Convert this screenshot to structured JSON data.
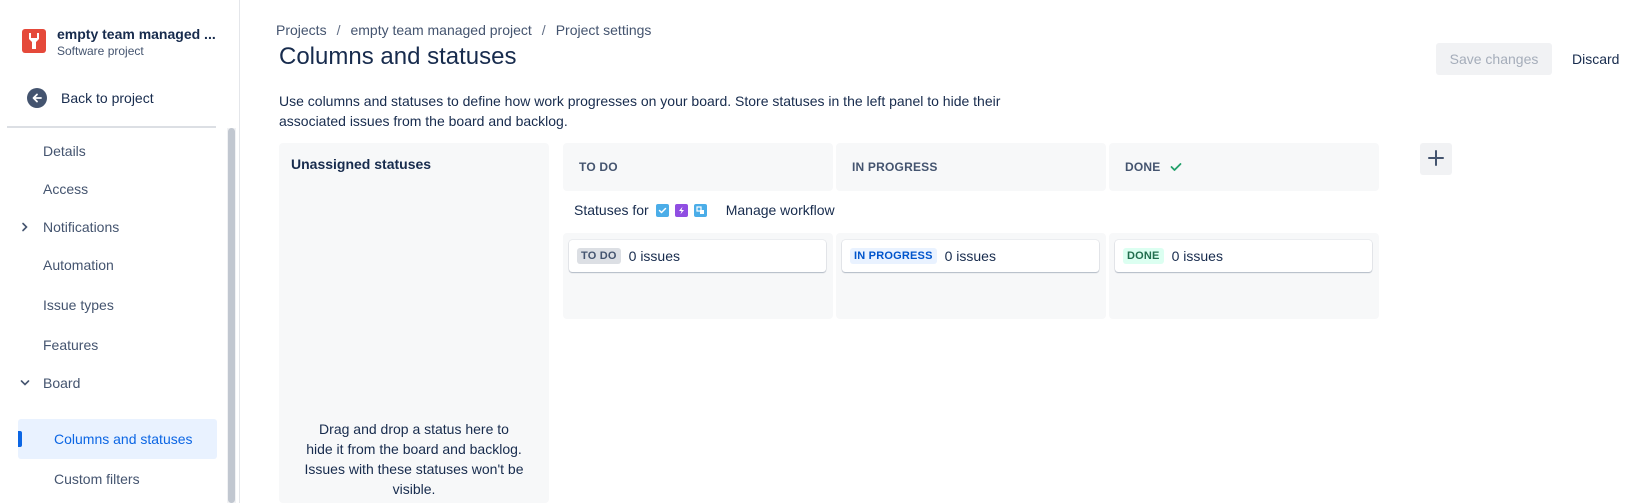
{
  "project": {
    "name": "empty team managed ...",
    "type": "Software project",
    "icon": "wrench-icon"
  },
  "sidebar": {
    "back_label": "Back to project",
    "items": [
      {
        "label": "Details"
      },
      {
        "label": "Access"
      },
      {
        "label": "Notifications",
        "chevron": "chevron-right"
      },
      {
        "label": "Automation"
      },
      {
        "label": "Issue types"
      },
      {
        "label": "Features"
      },
      {
        "label": "Board",
        "chevron": "chevron-down"
      },
      {
        "label": "Columns and statuses",
        "active": true
      },
      {
        "label": "Custom filters"
      }
    ]
  },
  "breadcrumb": [
    "Projects",
    "empty team managed project",
    "Project settings"
  ],
  "breadcrumb_sep": "/",
  "page_title": "Columns and statuses",
  "actions": {
    "save_label": "Save changes",
    "discard_label": "Discard"
  },
  "description": "Use columns and statuses to define how work progresses on your board. Store statuses in the left panel to hide their associated issues from the board and backlog.",
  "unassigned": {
    "title": "Unassigned statuses",
    "hint": "Drag and drop a status here to hide it from the board and backlog. Issues with these statuses won't be visible."
  },
  "statuses_for_label": "Statuses for",
  "manage_workflow_label": "Manage workflow",
  "columns": [
    {
      "header": "TO DO",
      "status": "TO DO",
      "count_label": "0 issues"
    },
    {
      "header": "IN PROGRESS",
      "status": "IN PROGRESS",
      "count_label": "0 issues"
    },
    {
      "header": "DONE",
      "status": "DONE",
      "count_label": "0 issues",
      "done_check": true
    }
  ],
  "colors": {
    "accent": "#0c66e4",
    "done_green": "#22a06b",
    "project_icon": "#e5493a"
  }
}
